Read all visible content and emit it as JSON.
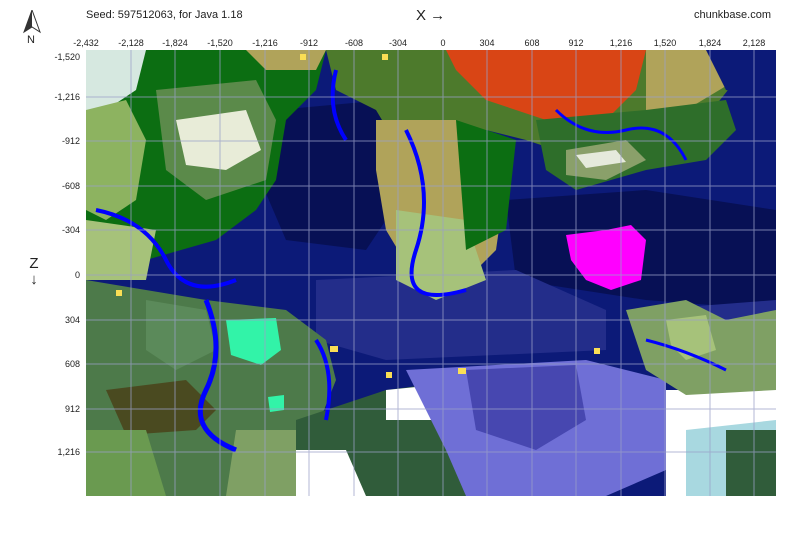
{
  "header": {
    "seed_text": "Seed: 597512063, for Java 1.18",
    "brand": "chunkbase.com",
    "x_axis_label": "X →",
    "z_axis_label": "Z",
    "z_arrow": "↓",
    "compass_label": "N"
  },
  "map": {
    "x_ticks": [
      "-2,432",
      "-2,128",
      "-1,824",
      "-1,520",
      "-1,216",
      "-912",
      "-608",
      "-304",
      "0",
      "304",
      "608",
      "912",
      "1,216",
      "1,520",
      "1,824",
      "2,128"
    ],
    "z_ticks": [
      "-1,520",
      "-1,216",
      "-912",
      "-608",
      "-304",
      "0",
      "304",
      "608",
      "912",
      "1,216"
    ],
    "biome_colors": {
      "deep_ocean": "#0c1a78",
      "ocean": "#1a1aa8",
      "deep_dark_ocean": "#071055",
      "lukewarm_ocean": "#232d8a",
      "frozen_ocean": "#6f6fd6",
      "river": "#0000ff",
      "forest": "#0c6e12",
      "plains": "#8db360",
      "savanna": "#b0a35a",
      "badlands": "#d94515",
      "mushroom": "#ff00ff",
      "beach": "#fade55",
      "snowy": "#ffffff",
      "taiga": "#305c3a",
      "cherry": "#32f3a8"
    }
  }
}
